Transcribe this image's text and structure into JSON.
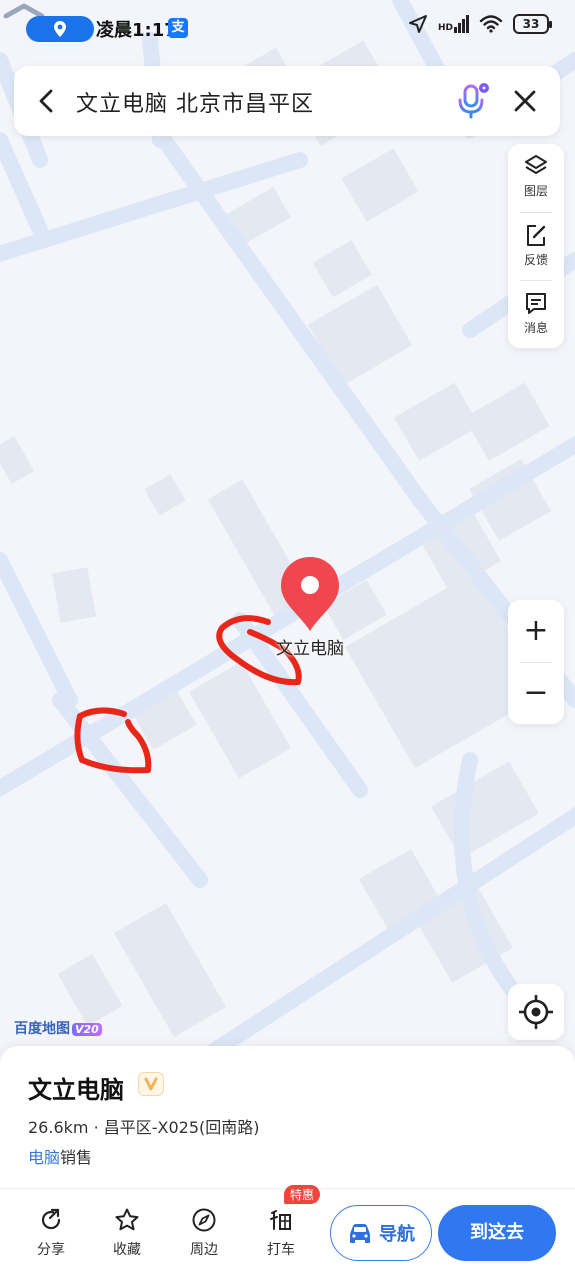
{
  "status_bar": {
    "time": "凌晨1:17",
    "alipay_badge": "支",
    "network_label": "HD",
    "battery": "33"
  },
  "search": {
    "query": "文立电脑 北京市昌平区"
  },
  "tool_panel": {
    "layers_label": "图层",
    "feedback_label": "反馈",
    "messages_label": "消息"
  },
  "zoom": {
    "zoom_in": "+",
    "zoom_out": "−"
  },
  "map": {
    "poi_label": "文立电脑",
    "logo": "百度地图",
    "version": "V20",
    "marker_color": "#f0474f"
  },
  "place": {
    "name": "文立电脑",
    "distance_info": "26.6km · 昌平区-X025(回南路)",
    "category_link": "电脑",
    "category_rest": "销售"
  },
  "actions": {
    "share": "分享",
    "favorite": "收藏",
    "nearby": "周边",
    "taxi": "打车",
    "taxi_badge": "特惠",
    "navigate": "导航",
    "go_here": "到这去"
  },
  "colors": {
    "accent": "#2f78f0",
    "road": "#dce8f7",
    "building": "#e3e7ef"
  }
}
